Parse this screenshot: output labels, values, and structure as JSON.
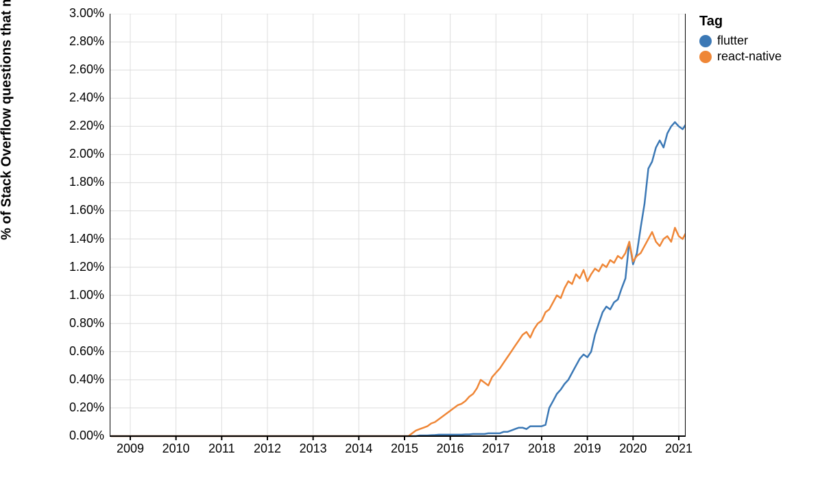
{
  "chart_data": {
    "type": "line",
    "ylabel": "% of Stack Overflow questions that month",
    "xlabel": "",
    "x": [
      "2008-08",
      "2008-09",
      "2008-10",
      "2008-11",
      "2008-12",
      "2009-01",
      "2009-02",
      "2009-03",
      "2009-04",
      "2009-05",
      "2009-06",
      "2009-07",
      "2009-08",
      "2009-09",
      "2009-10",
      "2009-11",
      "2009-12",
      "2010-01",
      "2010-02",
      "2010-03",
      "2010-04",
      "2010-05",
      "2010-06",
      "2010-07",
      "2010-08",
      "2010-09",
      "2010-10",
      "2010-11",
      "2010-12",
      "2011-01",
      "2011-02",
      "2011-03",
      "2011-04",
      "2011-05",
      "2011-06",
      "2011-07",
      "2011-08",
      "2011-09",
      "2011-10",
      "2011-11",
      "2011-12",
      "2012-01",
      "2012-02",
      "2012-03",
      "2012-04",
      "2012-05",
      "2012-06",
      "2012-07",
      "2012-08",
      "2012-09",
      "2012-10",
      "2012-11",
      "2012-12",
      "2013-01",
      "2013-02",
      "2013-03",
      "2013-04",
      "2013-05",
      "2013-06",
      "2013-07",
      "2013-08",
      "2013-09",
      "2013-10",
      "2013-11",
      "2013-12",
      "2014-01",
      "2014-02",
      "2014-03",
      "2014-04",
      "2014-05",
      "2014-06",
      "2014-07",
      "2014-08",
      "2014-09",
      "2014-10",
      "2014-11",
      "2014-12",
      "2015-01",
      "2015-02",
      "2015-03",
      "2015-04",
      "2015-05",
      "2015-06",
      "2015-07",
      "2015-08",
      "2015-09",
      "2015-10",
      "2015-11",
      "2015-12",
      "2016-01",
      "2016-02",
      "2016-03",
      "2016-04",
      "2016-05",
      "2016-06",
      "2016-07",
      "2016-08",
      "2016-09",
      "2016-10",
      "2016-11",
      "2016-12",
      "2017-01",
      "2017-02",
      "2017-03",
      "2017-04",
      "2017-05",
      "2017-06",
      "2017-07",
      "2017-08",
      "2017-09",
      "2017-10",
      "2017-11",
      "2017-12",
      "2018-01",
      "2018-02",
      "2018-03",
      "2018-04",
      "2018-05",
      "2018-06",
      "2018-07",
      "2018-08",
      "2018-09",
      "2018-10",
      "2018-11",
      "2018-12",
      "2019-01",
      "2019-02",
      "2019-03",
      "2019-04",
      "2019-05",
      "2019-06",
      "2019-07",
      "2019-08",
      "2019-09",
      "2019-10",
      "2019-11",
      "2019-12",
      "2020-01",
      "2020-02",
      "2020-03",
      "2020-04",
      "2020-05",
      "2020-06",
      "2020-07",
      "2020-08",
      "2020-09",
      "2020-10",
      "2020-11",
      "2020-12",
      "2021-01",
      "2021-02",
      "2021-03"
    ],
    "x_ticks_years": [
      2009,
      2010,
      2011,
      2012,
      2013,
      2014,
      2015,
      2016,
      2017,
      2018,
      2019,
      2020,
      2021
    ],
    "ylim": [
      0,
      3.0
    ],
    "y_ticks": [
      0.0,
      0.2,
      0.4,
      0.6,
      0.8,
      1.0,
      1.2,
      1.4,
      1.6,
      1.8,
      2.0,
      2.2,
      2.4,
      2.6,
      2.8,
      3.0
    ],
    "series": [
      {
        "name": "flutter",
        "color": "#3b78b5",
        "values": [
          0,
          0,
          0,
          0,
          0,
          0,
          0,
          0,
          0,
          0,
          0,
          0,
          0,
          0,
          0,
          0,
          0,
          0,
          0,
          0,
          0,
          0,
          0,
          0,
          0,
          0,
          0,
          0,
          0,
          0,
          0,
          0,
          0,
          0,
          0,
          0,
          0,
          0,
          0,
          0,
          0,
          0,
          0,
          0,
          0,
          0,
          0,
          0,
          0,
          0,
          0,
          0,
          0,
          0,
          0,
          0,
          0,
          0,
          0,
          0,
          0,
          0,
          0,
          0,
          0,
          0,
          0,
          0,
          0,
          0,
          0,
          0,
          0,
          0,
          0,
          0,
          0,
          0,
          0,
          0,
          0,
          0.005,
          0.005,
          0.005,
          0.007,
          0.008,
          0.01,
          0.01,
          0.01,
          0.01,
          0.01,
          0.01,
          0.01,
          0.012,
          0.012,
          0.015,
          0.015,
          0.015,
          0.015,
          0.02,
          0.02,
          0.02,
          0.02,
          0.03,
          0.03,
          0.04,
          0.05,
          0.06,
          0.06,
          0.05,
          0.07,
          0.07,
          0.07,
          0.07,
          0.08,
          0.2,
          0.25,
          0.3,
          0.33,
          0.37,
          0.4,
          0.45,
          0.5,
          0.55,
          0.58,
          0.56,
          0.6,
          0.72,
          0.8,
          0.88,
          0.92,
          0.9,
          0.95,
          0.97,
          1.05,
          1.12,
          1.38,
          1.22,
          1.3,
          1.48,
          1.65,
          1.9,
          1.95,
          2.05,
          2.1,
          2.05,
          2.15,
          2.2,
          2.23,
          2.2,
          2.18,
          2.22
        ]
      },
      {
        "name": "react-native",
        "color": "#ef8636",
        "values": [
          0,
          0,
          0,
          0,
          0,
          0,
          0,
          0,
          0,
          0,
          0,
          0,
          0,
          0,
          0,
          0,
          0,
          0,
          0,
          0,
          0,
          0,
          0,
          0,
          0,
          0,
          0,
          0,
          0,
          0,
          0,
          0,
          0,
          0,
          0,
          0,
          0,
          0,
          0,
          0,
          0,
          0,
          0,
          0,
          0,
          0,
          0,
          0,
          0,
          0,
          0,
          0,
          0,
          0,
          0,
          0,
          0,
          0,
          0,
          0,
          0,
          0,
          0,
          0,
          0,
          0,
          0,
          0,
          0,
          0,
          0,
          0,
          0,
          0,
          0,
          0,
          0,
          0,
          0,
          0.02,
          0.04,
          0.05,
          0.06,
          0.07,
          0.09,
          0.1,
          0.12,
          0.14,
          0.16,
          0.18,
          0.2,
          0.22,
          0.23,
          0.25,
          0.28,
          0.3,
          0.34,
          0.4,
          0.38,
          0.36,
          0.42,
          0.45,
          0.48,
          0.52,
          0.56,
          0.6,
          0.64,
          0.68,
          0.72,
          0.74,
          0.7,
          0.76,
          0.8,
          0.82,
          0.88,
          0.9,
          0.95,
          1.0,
          0.98,
          1.05,
          1.1,
          1.08,
          1.15,
          1.12,
          1.18,
          1.1,
          1.15,
          1.19,
          1.17,
          1.22,
          1.2,
          1.25,
          1.23,
          1.28,
          1.26,
          1.3,
          1.38,
          1.24,
          1.28,
          1.3,
          1.35,
          1.4,
          1.45,
          1.38,
          1.35,
          1.4,
          1.42,
          1.38,
          1.48,
          1.42,
          1.4,
          1.45
        ]
      }
    ],
    "legend": {
      "title": "Tag",
      "position": "right"
    }
  }
}
